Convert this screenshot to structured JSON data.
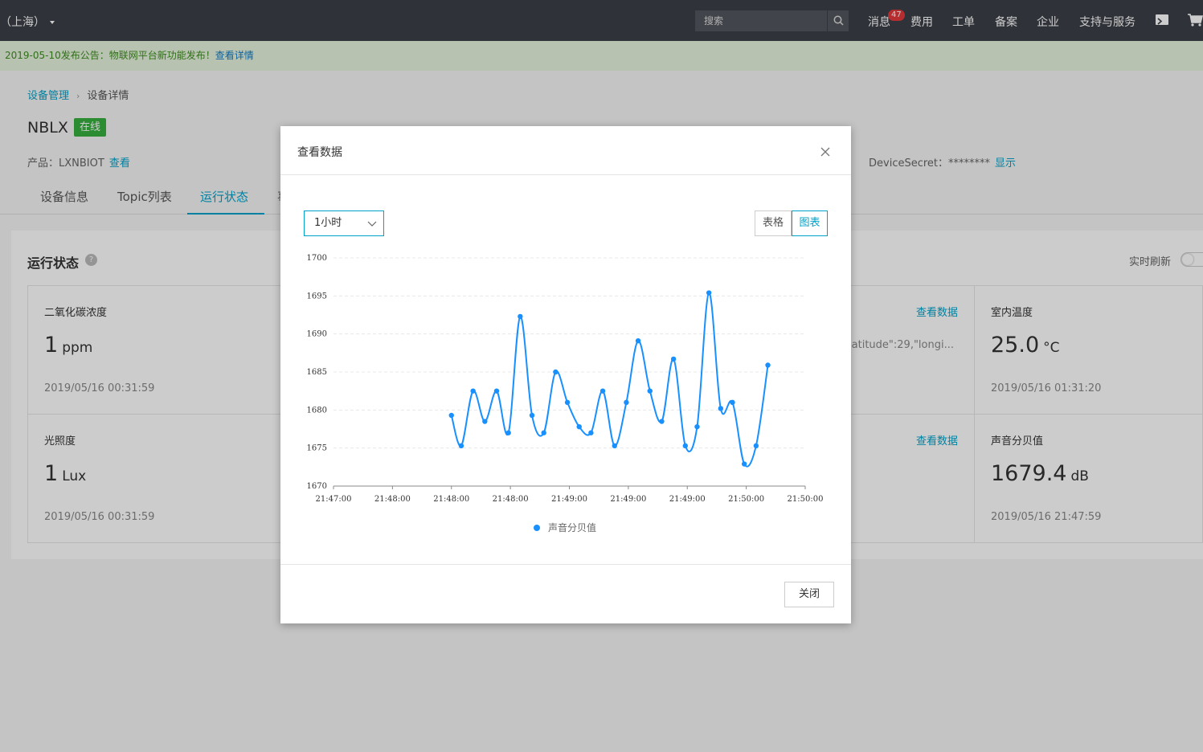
{
  "topbar": {
    "region": "（上海）",
    "search_placeholder": "搜索",
    "nav": [
      "消息",
      "费用",
      "工单",
      "备案",
      "企业",
      "支持与服务"
    ],
    "badge": "47"
  },
  "announcement": {
    "text": "2019-05-10发布公告：物联网平台新功能发布！",
    "link": "查看详情"
  },
  "breadcrumb": [
    "设备管理",
    "设备详情"
  ],
  "device": {
    "name": "NBLX",
    "status": "在线",
    "product_label": "产品：LXNBIOT",
    "product_link": "查看",
    "secret_label": "DeviceSecret：********",
    "secret_link": "显示"
  },
  "tabs": [
    "设备信息",
    "Topic列表",
    "运行状态",
    "事"
  ],
  "panel": {
    "title": "运行状态",
    "help": "?",
    "refresh_label": "实时刷新",
    "cells": [
      {
        "name": "二氧化碳浓度",
        "value": "1",
        "unit": "ppm",
        "time": "2019/05/16 00:31:59"
      },
      {
        "name": "光照度",
        "value": "1",
        "unit": "Lux",
        "time": "2019/05/16 00:31:59"
      },
      {
        "name": "室内温度",
        "value": "25.0",
        "unit": "°C",
        "time": "2019/05/16 01:31:20"
      },
      {
        "name": "声音分贝值",
        "value": "1679.4",
        "unit": "dB",
        "time": "2019/05/16 21:47:59"
      }
    ],
    "more_link": "查看数据",
    "geo_value": "\"latitude\":29,\"longi..."
  },
  "modal": {
    "title": "查看数据",
    "select_value": "1小时",
    "view_table": "表格",
    "view_chart": "图表",
    "close_button": "关闭"
  },
  "chart_data": {
    "type": "line",
    "x_tick_labels": [
      "21:47:00",
      "21:48:00",
      "21:48:00",
      "21:48:00",
      "21:49:00",
      "21:49:00",
      "21:49:00",
      "21:50:00",
      "21:50:00"
    ],
    "ylim": [
      1670,
      1700
    ],
    "y_ticks": [
      1670,
      1675,
      1680,
      1685,
      1690,
      1695,
      1700
    ],
    "legend": "声音分贝值",
    "color": "#1890ff",
    "x": [
      "21:48:00",
      "21:48:05",
      "21:48:11",
      "21:48:17",
      "21:48:23",
      "21:48:29",
      "21:48:35",
      "21:48:41",
      "21:48:47",
      "21:48:53",
      "21:48:59",
      "21:49:05",
      "21:49:11",
      "21:49:17",
      "21:49:23",
      "21:49:29",
      "21:49:35",
      "21:49:41",
      "21:49:47",
      "21:49:53",
      "21:49:59",
      "21:50:05",
      "21:50:11",
      "21:50:17",
      "21:50:23",
      "21:50:29",
      "21:50:35",
      "21:50:41",
      "21:50:47",
      "21:50:53",
      "21:50:59",
      "21:51:05",
      "21:51:11",
      "21:51:17"
    ],
    "values": [
      1679.3,
      1675.3,
      1682.5,
      1678.5,
      1682.5,
      1677.0,
      1692.3,
      1679.3,
      1677.0,
      1685.0,
      1681.0,
      1677.8,
      1677.0,
      1682.5,
      1675.3,
      1681.0,
      1689.1,
      1682.5,
      1678.5,
      1686.7,
      1675.3,
      1677.8,
      1695.4,
      1680.2,
      1681.0,
      1672.9,
      1675.3,
      1685.9
    ]
  }
}
